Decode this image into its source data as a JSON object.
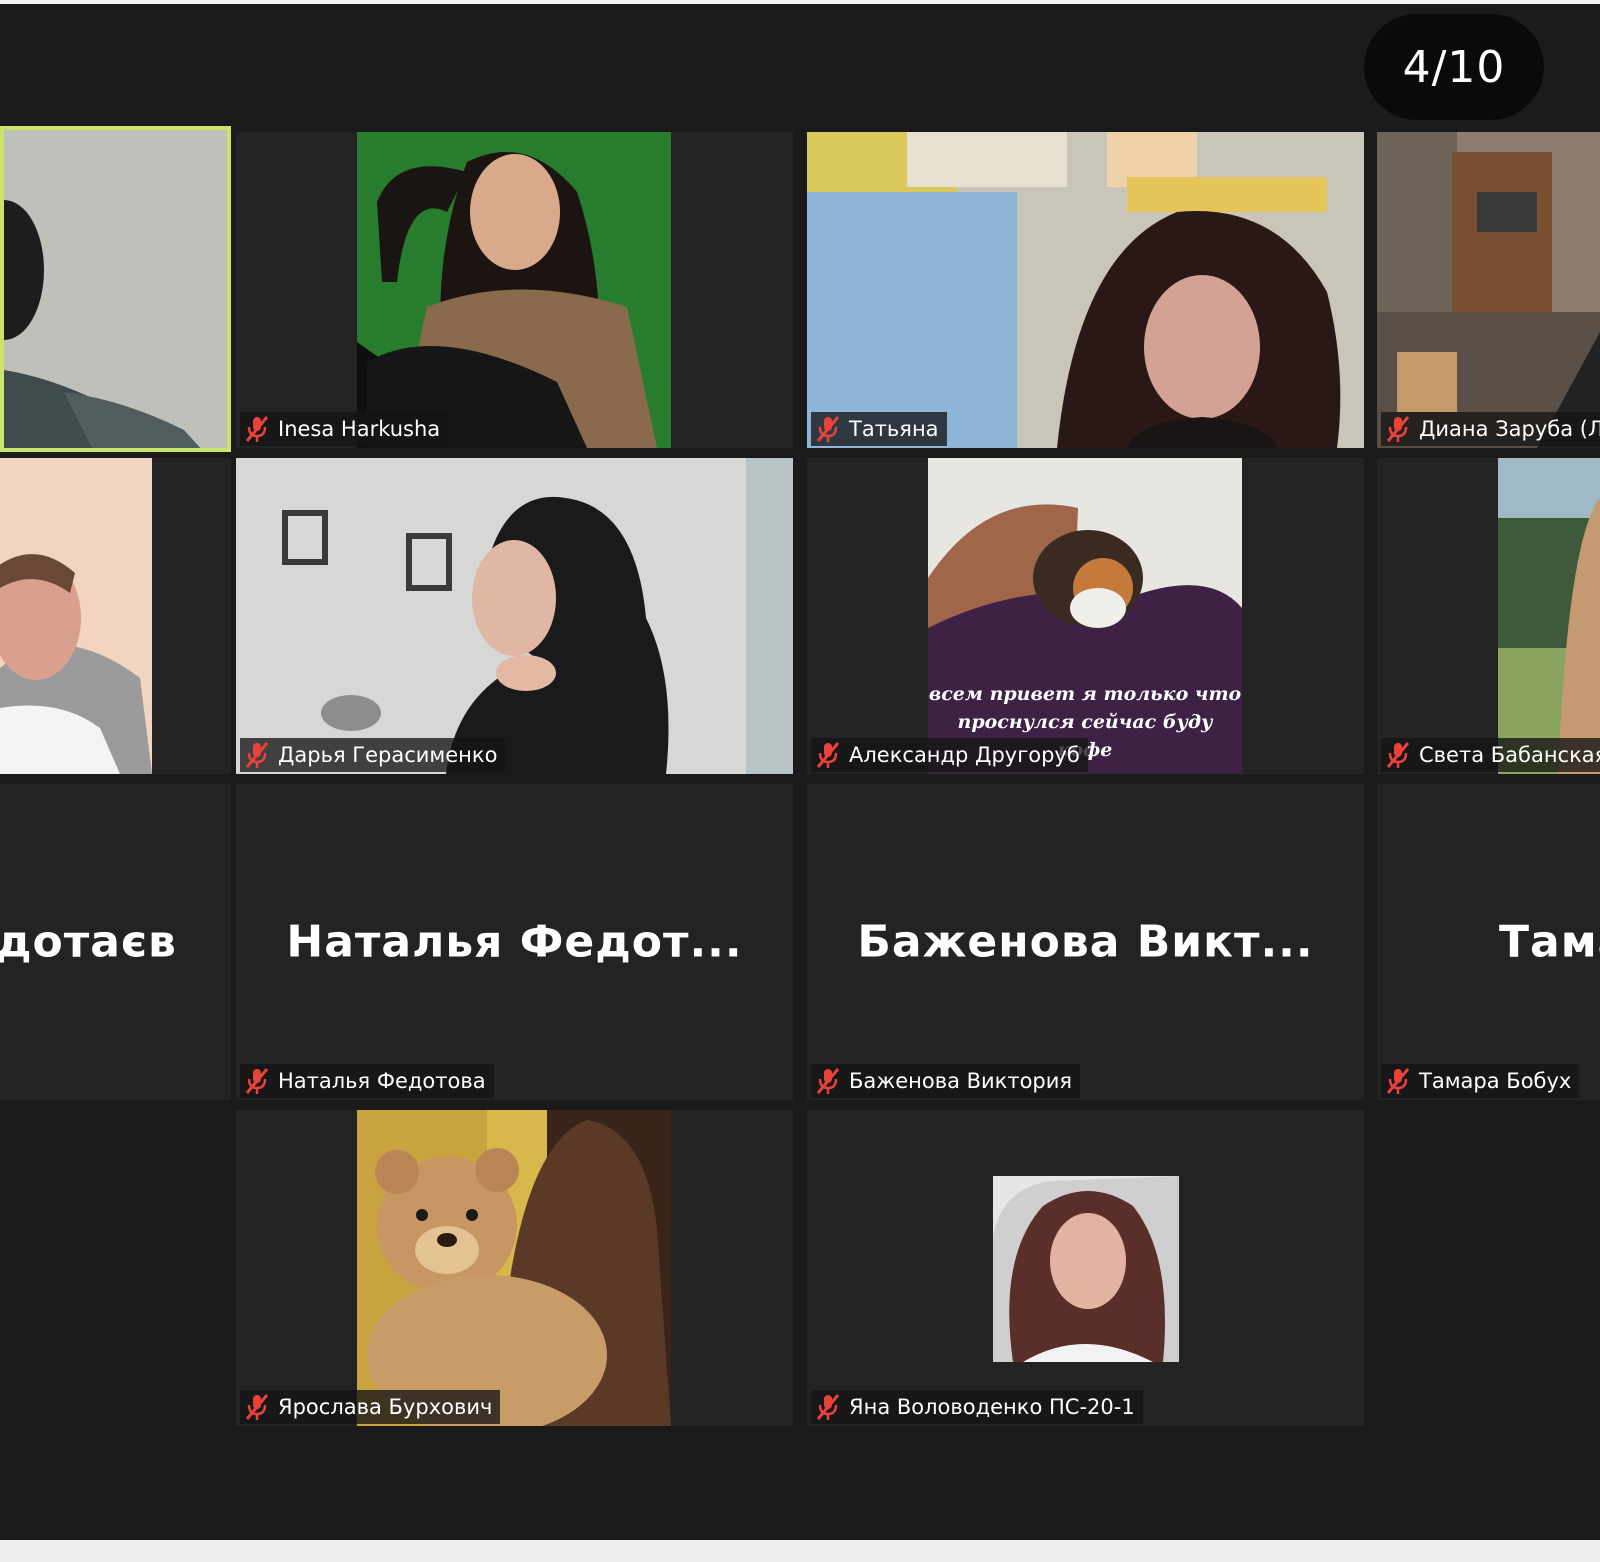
{
  "meeting": {
    "page_indicator": "4/10"
  },
  "tiles": {
    "t00": {
      "name": ""
    },
    "t01": {
      "name": "Inesa Harkusha"
    },
    "t02": {
      "name": "Татьяна"
    },
    "t03": {
      "name": "Диана Заруба (Л"
    },
    "t10": {
      "name": ""
    },
    "t11": {
      "name": "Дарья Герасименко"
    },
    "t12": {
      "name": "Александр Другоруб",
      "caption_line1": "всем привет я только что",
      "caption_line2": "проснулся сейчас буду",
      "caption_line3": "кофе"
    },
    "t13": {
      "name": "Света Бабанская"
    },
    "t20": {
      "avatar": "дотаєв"
    },
    "t21": {
      "avatar": "Наталья  Федот...",
      "name": "Наталья Федотова"
    },
    "t22": {
      "avatar": "Баженова  Викт...",
      "name": "Баженова Виктория"
    },
    "t23": {
      "avatar": "Тама",
      "name": "Тамара Бобух"
    },
    "t31": {
      "name": "Ярослава Бурхович"
    },
    "t32": {
      "name": "Яна Воловоденко ПС-20-1"
    }
  },
  "icons": {
    "mic_muted": "mic-muted-icon"
  },
  "colors": {
    "background": "#1a1a1a",
    "tile": "#232323",
    "active_speaker_border": "#c9e36b",
    "muted_icon": "#e8423b"
  }
}
